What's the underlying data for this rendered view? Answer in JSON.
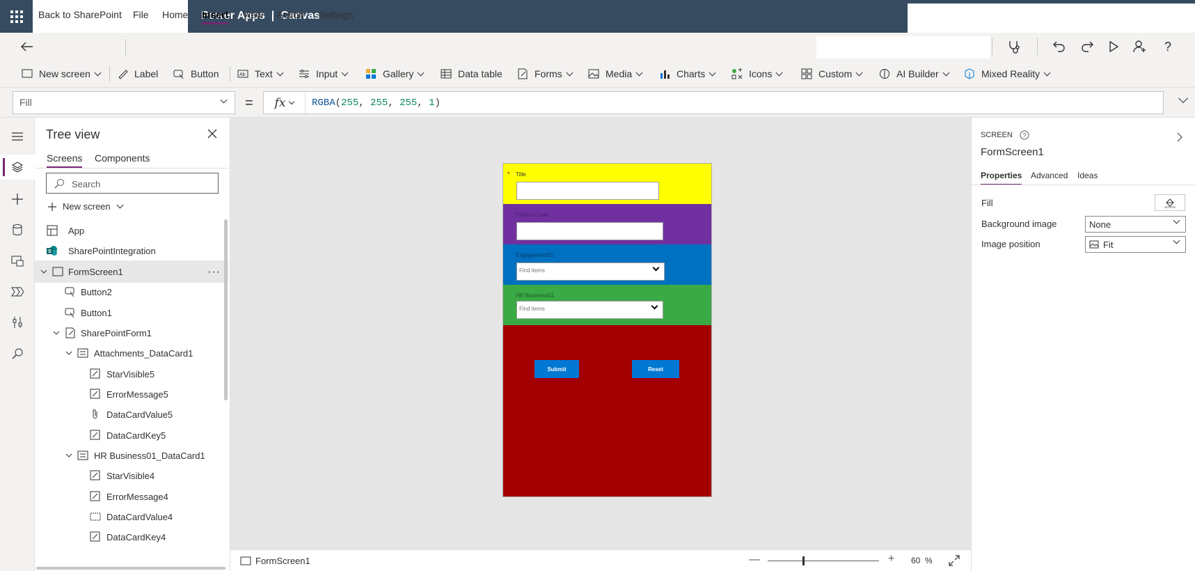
{
  "header": {
    "title": "Power Apps  |  Canvas"
  },
  "menu": {
    "back": "Back to SharePoint",
    "items": [
      "File",
      "Home",
      "Insert",
      "View",
      "Action",
      "Settings"
    ],
    "active": "Insert"
  },
  "ribbon": {
    "items": [
      {
        "label": "New screen",
        "icon": "new-screen-icon"
      },
      {
        "label": "Label",
        "icon": "label-icon"
      },
      {
        "label": "Button",
        "icon": "button-icon"
      },
      {
        "label": "Text",
        "icon": "text-icon"
      },
      {
        "label": "Input",
        "icon": "input-icon"
      },
      {
        "label": "Gallery",
        "icon": "gallery-icon"
      },
      {
        "label": "Data table",
        "icon": "data-table-icon"
      },
      {
        "label": "Forms",
        "icon": "forms-icon"
      },
      {
        "label": "Media",
        "icon": "media-icon"
      },
      {
        "label": "Charts",
        "icon": "charts-icon"
      },
      {
        "label": "Icons",
        "icon": "icons-icon"
      },
      {
        "label": "Custom",
        "icon": "custom-icon"
      },
      {
        "label": "AI Builder",
        "icon": "ai-builder-icon"
      },
      {
        "label": "Mixed Reality",
        "icon": "mixed-reality-icon"
      }
    ]
  },
  "formula": {
    "property": "Fill",
    "eq": "=",
    "fx": "fx",
    "fn": "RGBA",
    "open": "(",
    "args": [
      "255",
      "255",
      "255",
      "1"
    ],
    "sep": ", ",
    "close": ")"
  },
  "tree": {
    "title": "Tree view",
    "tabs": [
      "Screens",
      "Components"
    ],
    "search_placeholder": "Search",
    "new_screen": "New screen",
    "nodes": [
      {
        "label": "App",
        "icon": "app-icon"
      },
      {
        "label": "SharePointIntegration",
        "icon": "sharepoint-icon"
      },
      {
        "label": "FormScreen1",
        "icon": "screen-icon"
      },
      {
        "label": "Button2",
        "icon": "button-icon"
      },
      {
        "label": "Button1",
        "icon": "button-icon"
      },
      {
        "label": "SharePointForm1",
        "icon": "form-icon"
      },
      {
        "label": "Attachments_DataCard1",
        "icon": "datacard-icon"
      },
      {
        "label": "StarVisible5",
        "icon": "edit-icon"
      },
      {
        "label": "ErrorMessage5",
        "icon": "edit-icon"
      },
      {
        "label": "DataCardValue5",
        "icon": "attachment-icon"
      },
      {
        "label": "DataCardKey5",
        "icon": "edit-icon"
      },
      {
        "label": "HR Business01_DataCard1",
        "icon": "datacard-icon"
      },
      {
        "label": "StarVisible4",
        "icon": "edit-icon"
      },
      {
        "label": "ErrorMessage4",
        "icon": "edit-icon"
      },
      {
        "label": "DataCardValue4",
        "icon": "combobox-icon"
      },
      {
        "label": "DataCardKey4",
        "icon": "edit-icon"
      }
    ],
    "more": "···"
  },
  "form": {
    "title_label": "Title",
    "title_star": "*",
    "project_code_label": "Project Code",
    "engagement_label": "Engagement01",
    "engagement_placeholder": "Find items",
    "hr_label": "HR Business01",
    "hr_placeholder": "Find items",
    "submit": "Submit",
    "reset": "Reset",
    "colors": {
      "yellow": "#ffff00",
      "purple": "#7030a0",
      "blue": "#0070c0",
      "green": "#3aaa46",
      "red": "#a50000"
    }
  },
  "status": {
    "screen": "FormScreen1",
    "zoom": "60",
    "zoom_unit": "%",
    "minus": "—",
    "plus": "+"
  },
  "props": {
    "kind": "SCREEN",
    "name": "FormScreen1",
    "tabs": [
      "Properties",
      "Advanced",
      "Ideas"
    ],
    "fill_label": "Fill",
    "bg_label": "Background image",
    "bg_value": "None",
    "imgpos_label": "Image position",
    "imgpos_value": "Fit"
  }
}
